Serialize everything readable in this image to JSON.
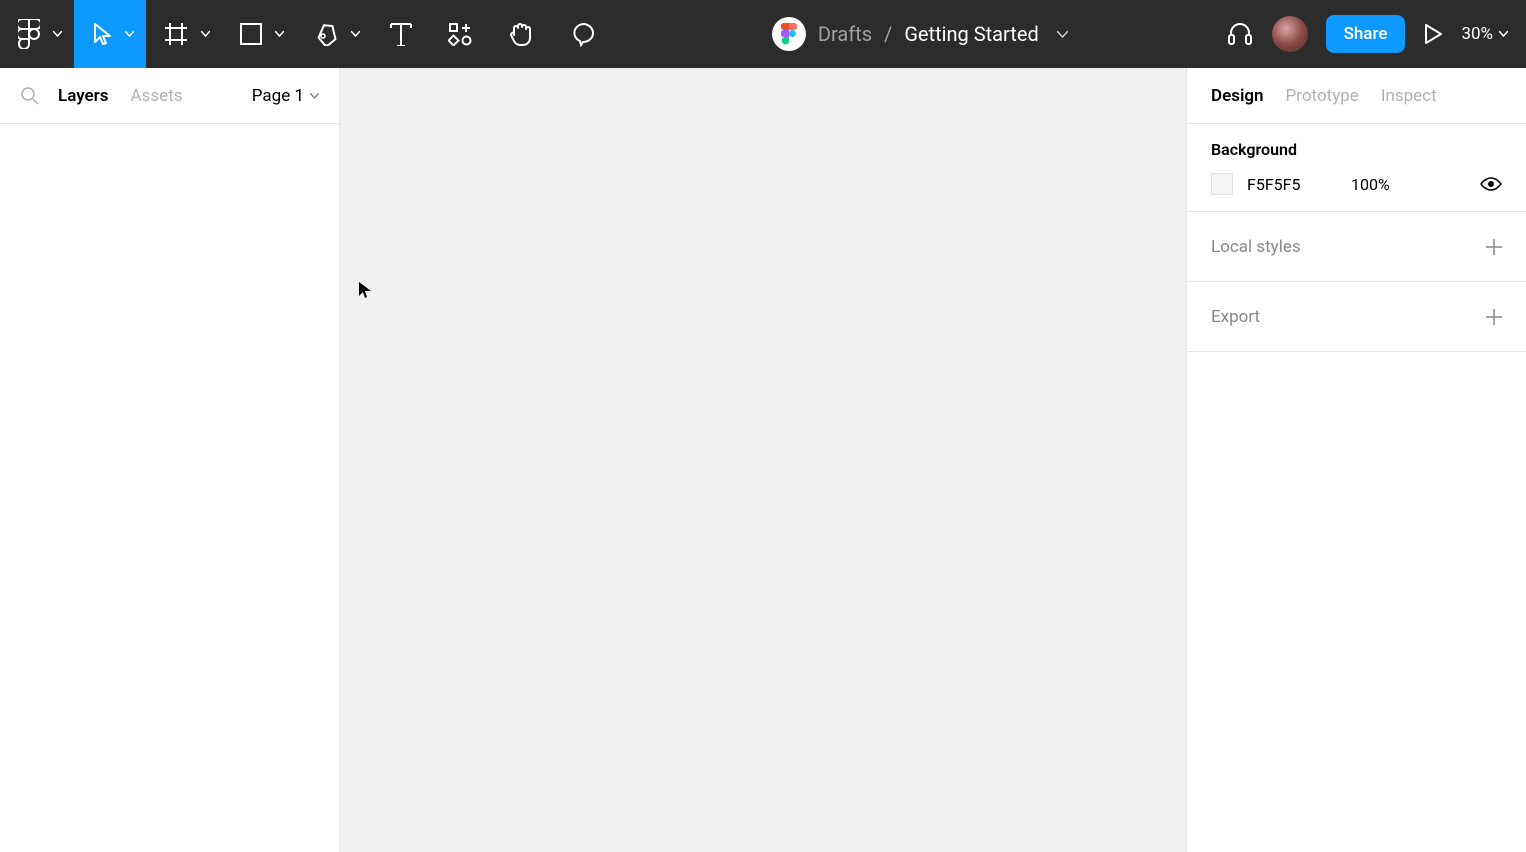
{
  "toolbar": {
    "breadcrumb_project": "Drafts",
    "breadcrumb_file": "Getting Started",
    "share_label": "Share",
    "zoom_label": "30%"
  },
  "left_panel": {
    "tabs": {
      "layers": "Layers",
      "assets": "Assets"
    },
    "page_selector": "Page 1"
  },
  "right_panel": {
    "tabs": {
      "design": "Design",
      "prototype": "Prototype",
      "inspect": "Inspect"
    },
    "background": {
      "label": "Background",
      "hex": "F5F5F5",
      "opacity": "100%"
    },
    "local_styles_label": "Local styles",
    "export_label": "Export"
  }
}
